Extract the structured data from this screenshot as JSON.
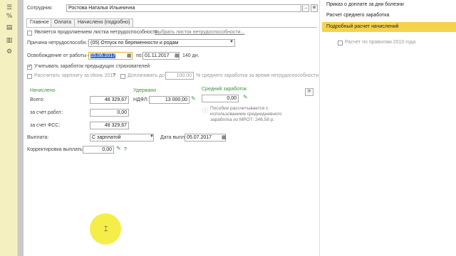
{
  "sidebar": {
    "icons": [
      "list-icon",
      "percent-icon",
      "docs-icon",
      "report-icon",
      "gear-icon"
    ],
    "glyphs": [
      "☰",
      "%",
      "▤",
      "▥",
      "⚙"
    ]
  },
  "form": {
    "employee_label": "Сотрудник:",
    "employee_value": "Ростова Наталья Ильинична",
    "tabs": [
      "Главное",
      "Оплата",
      "Начислено (подробно)"
    ],
    "continuation_label": "Является продолжением листка нетрудоспособности:",
    "continuation_link": "Выбрать листок нетрудоспособности...",
    "reason_label": "Причина нетрудоспособн.:",
    "reason_value": "(05) Отпуск по беременности и родам",
    "release_label": "Освобождение от работы с:",
    "date_from": "15.06.2017",
    "date_to_label": "по:",
    "date_to": "01.11.2017",
    "days": "140 дн.",
    "prev_insurers_label": "Учитывать заработок предыдущих страхователей",
    "calc_june_label": "Рассчитать зарплату за Июнь 2017",
    "extra_pay_label": "Доплачивать до",
    "extra_pay_value": "100.00",
    "extra_pay_suffix": "% среднего заработка за время нетрудоспособности",
    "accrued_header": "Начислено",
    "withheld_header": "Удержано",
    "avg_header": "Средний заработок",
    "total_label": "Всего:",
    "total_value": "48 329,67",
    "ndfl_label": "НДФЛ:",
    "ndfl_value": "13 000,00",
    "employer_label": "за счет работ.:",
    "employer_value": "0,00",
    "fss_label": "за счет ФСС:",
    "fss_value": "48 329,67",
    "avg_value": "0,00",
    "avg_note": "Пособие рассчитывается с использованием среднедневного заработка из МРОТ: 246,58 р.",
    "payout_label": "Выплата:",
    "payout_value": "С зарплатой",
    "payout_date_label": "Дата выплаты:",
    "payout_date": "05.07.2017",
    "correction_label": "Корректировка выплаты:",
    "correction_value": "0,00",
    "question": "?"
  },
  "menu": {
    "items": [
      "Приказ о доплате за дни болезни",
      "Расчет среднего заработка",
      "Подробный расчет начислений"
    ],
    "highlighted": 2
  },
  "right": {
    "calc_2010_label": "Расчет по правилам 2010 года"
  },
  "colors": {
    "highlight": "#f4d34d",
    "green": "#3f8f3f",
    "sidebar": "#f5f0bf"
  }
}
